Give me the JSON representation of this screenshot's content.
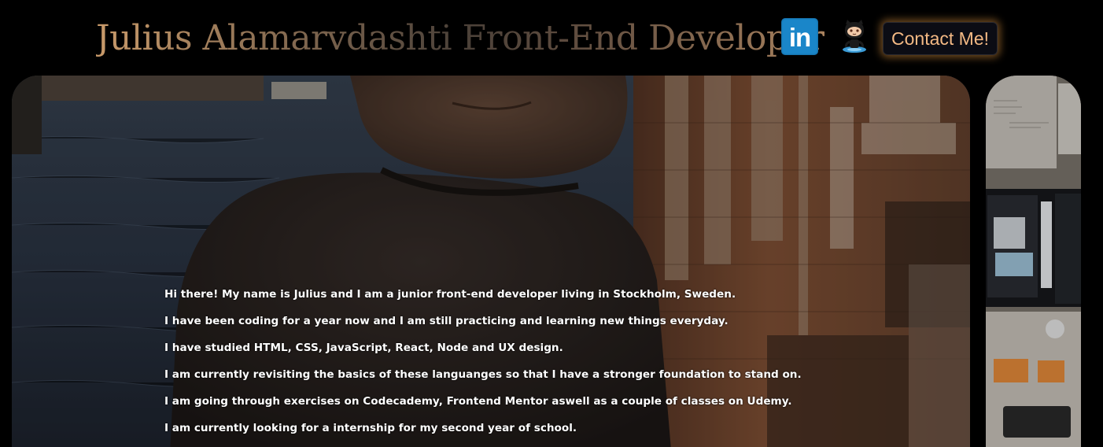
{
  "header": {
    "title": "Julius Alamarvdashti Front-End Developer",
    "contact_label": "Contact Me!",
    "linkedin_glyph": "in",
    "icons": [
      "linkedin-icon",
      "github-octocat-icon"
    ]
  },
  "hero": {
    "paragraphs": [
      "Hi there! My name is Julius and I am a junior front-end developer living in Stockholm, Sweden.",
      "I have been coding for a year now and I am still practicing and learning new things everyday.",
      "I have studied HTML, CSS, JavaScript, React, Node and UX design.",
      "I am currently revisiting the basics of these languanges so that I have a stronger foundation to stand on.",
      "I am going through exercises on Codecademy, Frontend Mentor aswell as a couple of classes on Udemy.",
      "I am currently looking for a internship for my second year of school."
    ]
  },
  "colors": {
    "accent": "#f3b984",
    "glow": "#d28c3c",
    "linkedin": "#1a86c9",
    "background": "#000000"
  }
}
